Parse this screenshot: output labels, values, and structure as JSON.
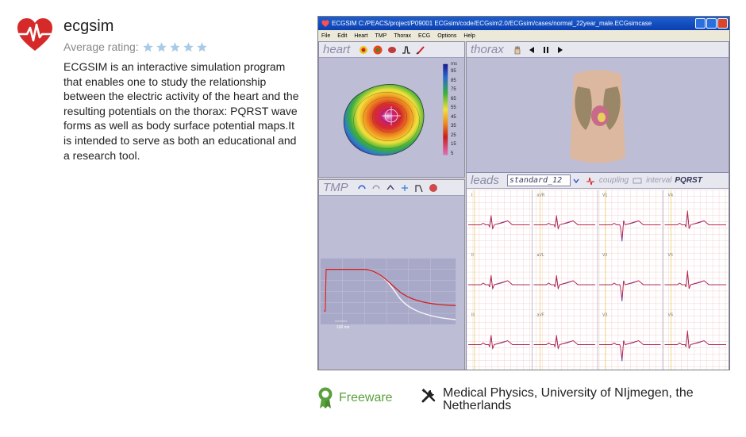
{
  "app": {
    "title": "ecgsim",
    "rating_label": "Average rating:",
    "description": "ECGSIM is an interactive simulation program that enables one to study the relationship between the electric activity of the heart and the resulting potentials on the thorax: PQRST wave forms as well as body surface potential maps.It is intended to serve as both an educational and a research tool."
  },
  "rating": {
    "stars": 5,
    "filled": 5,
    "star_color": "#a9cbe6"
  },
  "screenshot": {
    "window_title": "ECGSIM  C:/PEACS/project/P09001 ECGsim/code/ECGsim2.0/ECGsim/cases/normal_22year_male.ECGsimcase",
    "menu": [
      "File",
      "Edit",
      "Heart",
      "TMP",
      "Thorax",
      "ECG",
      "Options",
      "Help"
    ],
    "panes": {
      "heart": "heart",
      "thorax": "thorax",
      "tmp": "TMP",
      "leads": "leads"
    },
    "leads_select": "standard_12",
    "leads_coupling": "coupling",
    "leads_interval": "interval",
    "leads_mode": "PQRST",
    "legend_unit": "ms",
    "legend_ticks": [
      "95",
      "85",
      "75",
      "65",
      "55",
      "45",
      "35",
      "25",
      "15",
      "5"
    ],
    "lead_names": [
      "I",
      "aVR",
      "V1",
      "V4",
      "II",
      "aVL",
      "V2",
      "V5",
      "III",
      "aVF",
      "V3",
      "V6"
    ],
    "tmp_scale_label": "100 ms"
  },
  "footer": {
    "license": "Freeware",
    "developer": "Medical Physics, University of NIjmegen, the Netherlands"
  },
  "colors": {
    "brand_heart": "#d62a2a",
    "license_green": "#5aa03c",
    "titlebar_blue": "#0a3fb0"
  }
}
